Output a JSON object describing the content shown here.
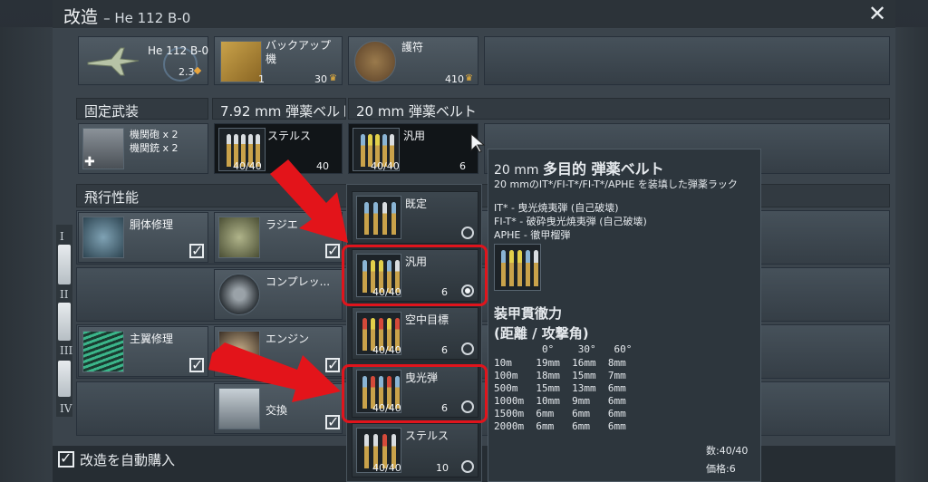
{
  "window": {
    "title": "改造",
    "subtitle": "– He 112 B-0"
  },
  "top_row": {
    "aircraft": {
      "name": "He 112 B-0",
      "value": "2.3"
    },
    "backup": {
      "label": "バックアップ\n機",
      "count": "1",
      "price": "30"
    },
    "talisman": {
      "label": "護符",
      "price": "410"
    }
  },
  "headers": {
    "fixed_weapons": "固定武装",
    "belt_792": "7.92 mm 弾薬ベルト",
    "belt_20": "20 mm 弾薬ベルト",
    "flight": "飛行性能"
  },
  "weapons": {
    "guns": "機関砲 x 2\n機関銃 x 2",
    "belt_792_name": "ステルス",
    "belt_792_ammo": "40/40",
    "belt_792_price": "40",
    "belt_20_name": "汎用",
    "belt_20_ammo": "40/40",
    "belt_20_price": "6"
  },
  "flight_mods": [
    {
      "label": "胴体修理"
    },
    {
      "label": "ラジエ"
    },
    {
      "label": "コンプレッ..."
    },
    {
      "label": "主翼修理"
    },
    {
      "label": "エンジン"
    },
    {
      "label": "交換"
    }
  ],
  "tiers": [
    "I",
    "II",
    "III",
    "IV"
  ],
  "dropdown": [
    {
      "label": "既定",
      "ammo": "",
      "price": "",
      "selected": false
    },
    {
      "label": "汎用",
      "ammo": "40/40",
      "price": "6",
      "selected": true
    },
    {
      "label": "空中目標",
      "ammo": "40/40",
      "price": "6",
      "selected": false
    },
    {
      "label": "曳光弾",
      "ammo": "40/40",
      "price": "6",
      "selected": false
    },
    {
      "label": "ステルス",
      "ammo": "40/40",
      "price": "10",
      "selected": false
    }
  ],
  "tooltip": {
    "title_a": "20 mm ",
    "title_b": "多目的 弾薬ベルト",
    "desc": "20 mmのIT*/FI-T*/FI-T*/APHE を装填した弾薬ラック",
    "lines": [
      "IT* - 曳光焼夷弾 (自己破壊)",
      "FI-T* - 破砕曳光焼夷弾 (自己破壊)",
      "APHE - 徹甲榴弾"
    ],
    "pen_title": "装甲貫徹力",
    "pen_sub": "(距離 / 攻撃角)",
    "pen_header": "        0°    30°   60°",
    "pen_rows": [
      "10m    19mm  16mm  8mm",
      "100m   18mm  15mm  7mm",
      "500m   15mm  13mm  6mm",
      "1000m  10mm  9mm   6mm",
      "1500m  6mm   6mm   6mm",
      "2000m  6mm   6mm   6mm"
    ],
    "count": "数:40/40",
    "price": "価格:6"
  },
  "footer": {
    "auto_buy": "改造を自動購入"
  },
  "colors": {
    "highlight": "#e0141c",
    "arrow": "#e3141a"
  }
}
